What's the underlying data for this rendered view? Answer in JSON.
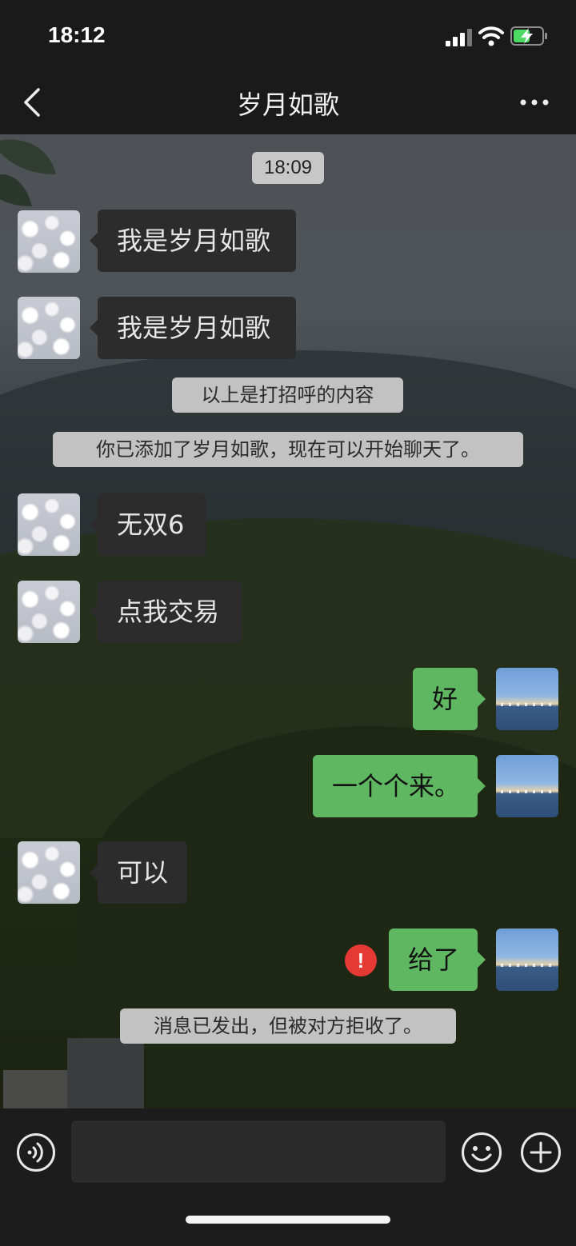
{
  "status_bar": {
    "time": "18:12"
  },
  "nav": {
    "title": "岁月如歌"
  },
  "chat": {
    "timestamp": "18:09",
    "messages": [
      {
        "from": "contact",
        "text": "我是岁月如歌"
      },
      {
        "from": "contact",
        "text": "我是岁月如歌"
      },
      {
        "system": "以上是打招呼的内容"
      },
      {
        "system": "你已添加了岁月如歌，现在可以开始聊天了。"
      },
      {
        "from": "contact",
        "text": "无双6"
      },
      {
        "from": "contact",
        "text": "点我交易"
      },
      {
        "from": "me",
        "text": "好"
      },
      {
        "from": "me",
        "text": "一个个来。"
      },
      {
        "from": "contact",
        "text": "可以"
      },
      {
        "from": "me",
        "text": "给了",
        "error": "!"
      },
      {
        "system": "消息已发出，但被对方拒收了。"
      }
    ]
  },
  "colors": {
    "out_bubble": "#5fb861",
    "in_bubble": "#2c2c2c",
    "error": "#e53935"
  },
  "icons": [
    "back-arrow-icon",
    "more-dots-icon",
    "voice-icon",
    "emoji-icon",
    "plus-icon",
    "signal-icon",
    "wifi-icon",
    "battery-charging-icon"
  ]
}
